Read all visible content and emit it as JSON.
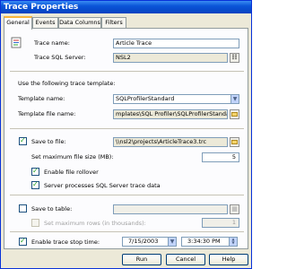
{
  "window": {
    "title": "Trace Properties"
  },
  "tabs": [
    {
      "label": "General"
    },
    {
      "label": "Events"
    },
    {
      "label": "Data Columns"
    },
    {
      "label": "Filters"
    }
  ],
  "trace": {
    "name_label": "Trace name:",
    "name_value": "Article Trace",
    "server_label": "Trace SQL Server:",
    "server_value": "NSL2"
  },
  "template": {
    "heading": "Use the following trace template:",
    "name_label": "Template name:",
    "name_value": "SQLProfilerStandard",
    "file_label": "Template file name:",
    "file_value": "mplates\\SQL Profiler\\SQLProfilerStandard.tdf"
  },
  "save_file": {
    "label": "Save to file:",
    "path": "\\\\nsl2\\projects\\ArticleTrace3.trc",
    "maxsize_label": "Set maximum file size (MB):",
    "maxsize_value": "5",
    "rollover_label": "Enable file rollover",
    "serverproc_label": "Server processes SQL Server trace data"
  },
  "save_table": {
    "label": "Save to table:",
    "maxrows_label": "Set maximum rows (in thousands):",
    "maxrows_value": "1"
  },
  "stop_time": {
    "label": "Enable trace stop time:",
    "date": "7/15/2003",
    "time": "3:34:30 PM"
  },
  "buttons": {
    "run": "Run",
    "cancel": "Cancel",
    "help": "Help"
  }
}
